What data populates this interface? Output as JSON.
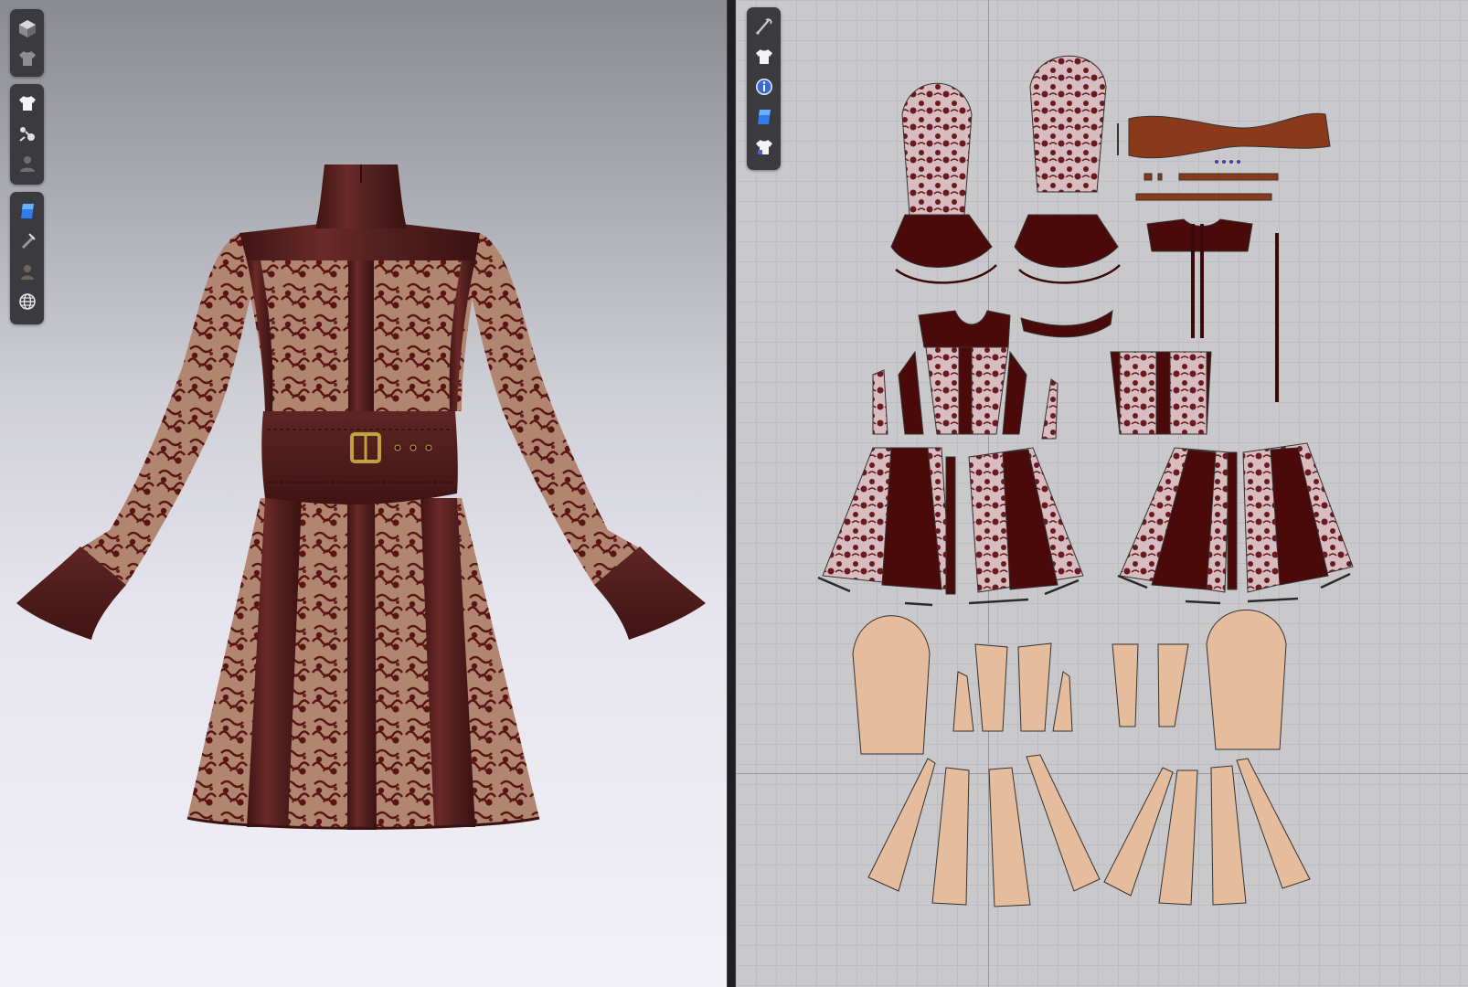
{
  "app": {
    "layout": "dual-view",
    "accent_color": "#4a90ff",
    "garment_colors": {
      "leather": "#4a1a1a",
      "lace_base": "#b48a74",
      "lace_motif": "#5a1818",
      "pattern_fill_dark": "#4b0a0a",
      "pattern_fill_light": "#e6bd9c",
      "buckle": "#b89a3c"
    }
  },
  "viewport3d": {
    "toolbar_a": [
      {
        "icon": "avatar-cube-icon"
      },
      {
        "icon": "garment-shirt-icon"
      }
    ],
    "toolbar_b": [
      {
        "icon": "show-garment-icon"
      },
      {
        "icon": "sewing-icon"
      },
      {
        "icon": "show-avatar-icon"
      }
    ],
    "toolbar_c": [
      {
        "icon": "texture-render-icon"
      },
      {
        "icon": "lighting-icon"
      },
      {
        "icon": "avatar-skin-icon"
      },
      {
        "icon": "globe-icon"
      }
    ]
  },
  "viewport2d": {
    "toolbar": [
      {
        "icon": "edit-pattern-icon"
      },
      {
        "icon": "garment-icon"
      },
      {
        "icon": "info-icon"
      },
      {
        "icon": "texture-2d-icon"
      },
      {
        "icon": "garment-lock-icon"
      }
    ]
  }
}
